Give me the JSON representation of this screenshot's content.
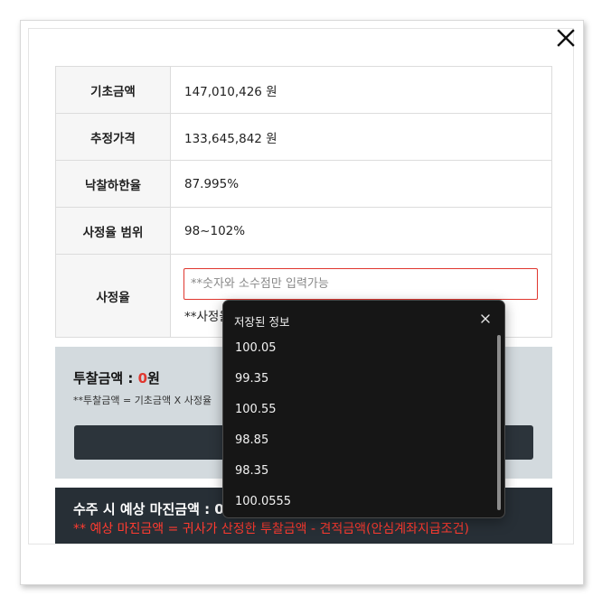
{
  "table": {
    "rows": [
      {
        "label": "기초금액",
        "value": "147,010,426 원"
      },
      {
        "label": "추정가격",
        "value": "133,645,842 원"
      },
      {
        "label": "낙찰하한율",
        "value": "87.995%"
      },
      {
        "label": "사정율 범위",
        "value": "98~102%"
      }
    ],
    "rate": {
      "label": "사정율",
      "placeholder": "**숫자와 소수점만 입력가능",
      "note": "**사정율"
    }
  },
  "bid": {
    "title": "투찰금액 : ",
    "amount": "0",
    "unit": "원",
    "formula": "**투찰금액 = 기초금액 X 사정율"
  },
  "margin": {
    "title": "수주 시 예상 마진금액 : 0",
    "formula": "** 예상 마진금액 = 귀사가 산정한 투찰금액 - 견적금액(안심계좌지급조건)"
  },
  "autocomplete": {
    "header": "저장된 정보",
    "items": [
      "100.05",
      "99.35",
      "100.55",
      "98.85",
      "98.35",
      "100.0555"
    ]
  },
  "colors": {
    "accent_red": "#e0372f",
    "dropdown_bg": "#161616",
    "bid_box_bg": "#d3dade",
    "margin_box_bg": "#272f36"
  }
}
